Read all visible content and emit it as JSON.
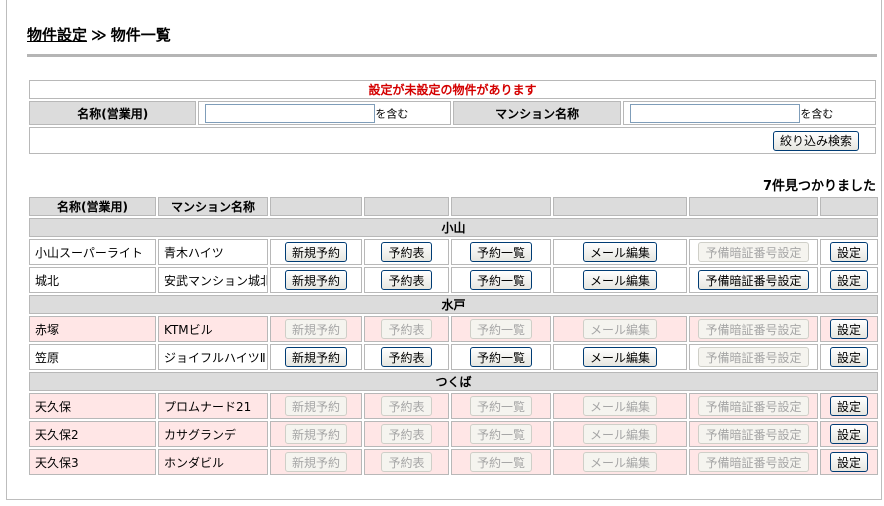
{
  "breadcrumb": {
    "parent": "物件設定",
    "separator": "≫",
    "current": "物件一覧"
  },
  "filter": {
    "notice": "設定が未設定の物件があります",
    "name_label": "名称(営業用)",
    "name_value": "",
    "name_suffix": "を含む",
    "mansion_label": "マンション名称",
    "mansion_value": "",
    "mansion_suffix": "を含む",
    "search_button": "絞り込み検索"
  },
  "result_count": "7件見つかりました",
  "table": {
    "col_name": "名称(営業用)",
    "col_mansion": "マンション名称",
    "labels": {
      "new": "新規予約",
      "sched": "予約表",
      "list": "予約一覧",
      "mail": "メール編集",
      "pin": "予備暗証番号設定",
      "settings": "設定"
    },
    "groups": [
      {
        "name": "小山",
        "rows": [
          {
            "name": "小山スーパーライト",
            "mansion": "青木ハイツ",
            "warn": false,
            "pin_enabled": false
          },
          {
            "name": "城北",
            "mansion": "安武マンション城北",
            "warn": false,
            "pin_enabled": true
          }
        ]
      },
      {
        "name": "水戸",
        "rows": [
          {
            "name": "赤塚",
            "mansion": "KTMビル",
            "warn": true,
            "pin_enabled": false
          },
          {
            "name": "笠原",
            "mansion": "ジョイフルハイツⅡ",
            "warn": false,
            "pin_enabled": false
          }
        ]
      },
      {
        "name": "つくば",
        "rows": [
          {
            "name": "天久保",
            "mansion": "プロムナード21",
            "warn": true,
            "pin_enabled": false
          },
          {
            "name": "天久保2",
            "mansion": "カサグランデ",
            "warn": true,
            "pin_enabled": false
          },
          {
            "name": "天久保3",
            "mansion": "ホンダビル",
            "warn": true,
            "pin_enabled": false
          }
        ]
      }
    ]
  }
}
